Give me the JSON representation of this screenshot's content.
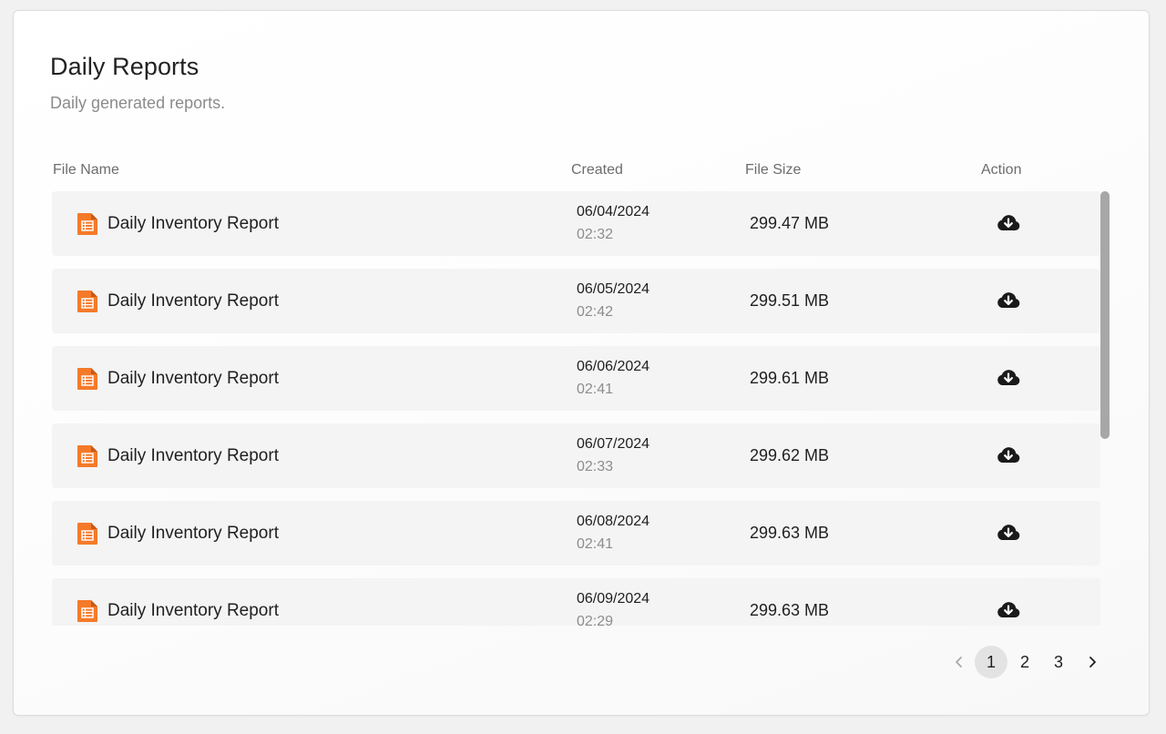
{
  "header": {
    "title": "Daily Reports",
    "subtitle": "Daily generated reports."
  },
  "table": {
    "columns": {
      "file_name": "File Name",
      "created": "Created",
      "file_size": "File Size",
      "action": "Action"
    },
    "rows": [
      {
        "name": "Daily Inventory Report",
        "date": "06/04/2024",
        "time": "02:32",
        "size": "299.47 MB"
      },
      {
        "name": "Daily Inventory Report",
        "date": "06/05/2024",
        "time": "02:42",
        "size": "299.51 MB"
      },
      {
        "name": "Daily Inventory Report",
        "date": "06/06/2024",
        "time": "02:41",
        "size": "299.61 MB"
      },
      {
        "name": "Daily Inventory Report",
        "date": "06/07/2024",
        "time": "02:33",
        "size": "299.62 MB"
      },
      {
        "name": "Daily Inventory Report",
        "date": "06/08/2024",
        "time": "02:41",
        "size": "299.63 MB"
      },
      {
        "name": "Daily Inventory Report",
        "date": "06/09/2024",
        "time": "02:29",
        "size": "299.63 MB"
      }
    ]
  },
  "pagination": {
    "prev_icon": "chevron-left-icon",
    "pages": [
      "1",
      "2",
      "3"
    ],
    "current_page": "1",
    "next_icon": "chevron-right-icon"
  },
  "icons": {
    "file": "spreadsheet-file-icon",
    "download": "cloud-download-icon"
  },
  "colors": {
    "file_icon": "#f47a2a",
    "row_background": "#f4f4f4",
    "active_page": "#e3e3e3"
  }
}
